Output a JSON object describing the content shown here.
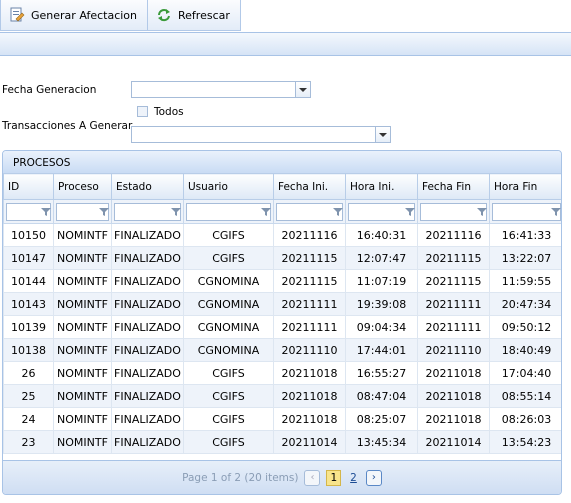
{
  "toolbar": {
    "generar_label": "Generar Afectacion",
    "refrescar_label": "Refrescar"
  },
  "form": {
    "fecha_label": "Fecha Generacion",
    "fecha_value": "",
    "todos_label": "Todos",
    "transacciones_label": "Transacciones A Generar",
    "transacciones_value": ""
  },
  "grid": {
    "title": "PROCESOS",
    "columns": [
      "ID",
      "Proceso",
      "Estado",
      "Usuario",
      "Fecha Ini.",
      "Hora Ini.",
      "Fecha Fin",
      "Hora Fin"
    ],
    "rows": [
      [
        "10150",
        "NOMINTF",
        "FINALIZADO",
        "CGIFS",
        "20211116",
        "16:40:31",
        "20211116",
        "16:41:33"
      ],
      [
        "10147",
        "NOMINTF",
        "FINALIZADO",
        "CGIFS",
        "20211115",
        "12:07:47",
        "20211115",
        "13:22:07"
      ],
      [
        "10144",
        "NOMINTF",
        "FINALIZADO",
        "CGNOMINA",
        "20211115",
        "11:07:19",
        "20211115",
        "11:59:55"
      ],
      [
        "10143",
        "NOMINTF",
        "FINALIZADO",
        "CGNOMINA",
        "20211111",
        "19:39:08",
        "20211111",
        "20:47:34"
      ],
      [
        "10139",
        "NOMINTF",
        "FINALIZADO",
        "CGNOMINA",
        "20211111",
        "09:04:34",
        "20211111",
        "09:50:12"
      ],
      [
        "10138",
        "NOMINTF",
        "FINALIZADO",
        "CGNOMINA",
        "20211110",
        "17:44:01",
        "20211110",
        "18:40:49"
      ],
      [
        "26",
        "NOMINTF",
        "FINALIZADO",
        "CGIFS",
        "20211018",
        "16:55:27",
        "20211018",
        "17:04:40"
      ],
      [
        "25",
        "NOMINTF",
        "FINALIZADO",
        "CGIFS",
        "20211018",
        "08:47:04",
        "20211018",
        "08:55:14"
      ],
      [
        "24",
        "NOMINTF",
        "FINALIZADO",
        "CGIFS",
        "20211018",
        "08:25:07",
        "20211018",
        "08:26:03"
      ],
      [
        "23",
        "NOMINTF",
        "FINALIZADO",
        "CGIFS",
        "20211014",
        "13:45:34",
        "20211014",
        "13:54:23"
      ]
    ]
  },
  "pager": {
    "summary": "Page 1 of 2 (20 items)",
    "pages": [
      "1",
      "2"
    ],
    "current_page": "1"
  },
  "colors": {
    "accent": "#c9dcf4",
    "border": "#a8c3e6",
    "current_page": "#f8e48b"
  }
}
